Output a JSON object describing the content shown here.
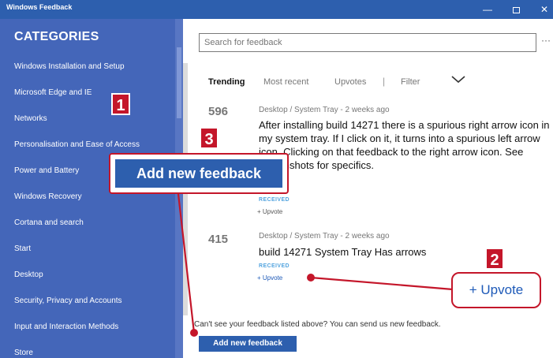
{
  "window": {
    "title": "Windows Feedback",
    "min_glyph": "—",
    "close_glyph": "✕"
  },
  "sidebar": {
    "heading": "CATEGORIES",
    "items": [
      "Windows Installation and Setup",
      "Microsoft Edge and IE",
      "Networks",
      "Personalisation and Ease of Access",
      "Power and Battery",
      "Windows Recovery",
      "Cortana and search",
      "Start",
      "Desktop",
      "Security, Privacy and Accounts",
      "Input and Interaction Methods",
      "Store"
    ]
  },
  "search": {
    "placeholder": "Search for feedback"
  },
  "more_glyph": "···",
  "tabs": {
    "trending": "Trending",
    "recent": "Most recent",
    "upvotes": "Upvotes",
    "separator": "|",
    "filter": "Filter"
  },
  "feedback": [
    {
      "count": "596",
      "meta": "Desktop / System Tray - 2 weeks ago",
      "title": "After installing build 14271 there is a spurious right arrow icon in my system tray. If I click on it, it turns into a spurious left arrow icon. Clicking on that feedback to the right arrow icon. See screenshots for specifics.",
      "status": "RECEIVED",
      "upvote": "+ Upvote"
    },
    {
      "count": "415",
      "meta": "Desktop / System Tray - 2 weeks ago",
      "title": "build 14271 System Tray Has arrows",
      "status": "RECEIVED",
      "upvote": "+ Upvote"
    }
  ],
  "footer": {
    "prompt": "Can't see your feedback listed above? You can send us new feedback.",
    "add_button": "Add new feedback"
  },
  "annotations": {
    "badge1": "1",
    "badge2": "2",
    "badge3": "3",
    "callout_add": "Add new feedback",
    "callout_upvote": "+ Upvote",
    "accent": "#c4162a"
  },
  "colors": {
    "titlebar": "#2d5fae",
    "sidebar": "#4466b9",
    "status": "#52a4df"
  }
}
